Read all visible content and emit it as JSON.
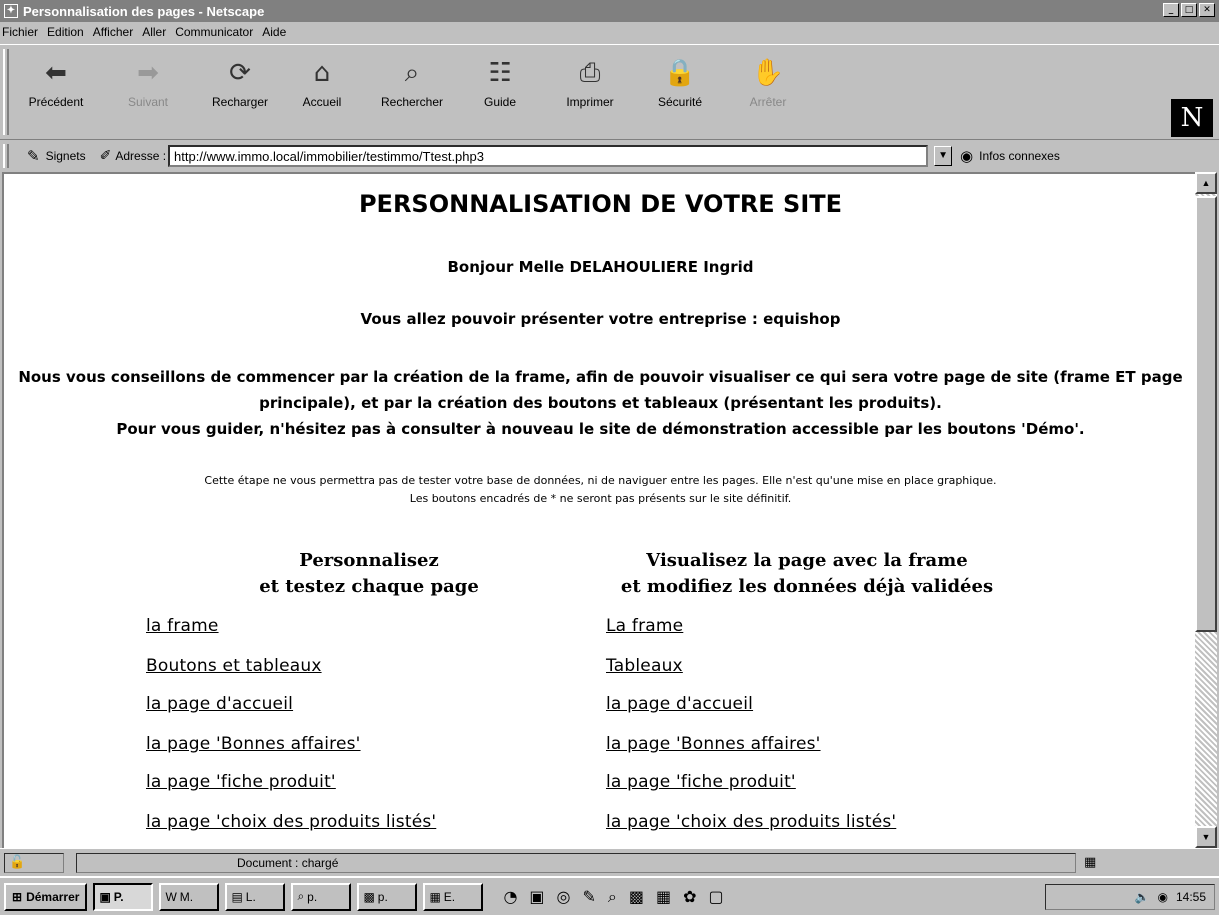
{
  "window": {
    "title": "Personnalisation des pages - Netscape"
  },
  "menu": [
    "Fichier",
    "Edition",
    "Afficher",
    "Aller",
    "Communicator",
    "Aide"
  ],
  "toolbar": {
    "buttons": [
      {
        "label": "Précédent",
        "icon": "back-icon",
        "glyph": "⬅"
      },
      {
        "label": "Suivant",
        "icon": "forward-icon",
        "glyph": "➡"
      },
      {
        "label": "Recharger",
        "icon": "reload-icon",
        "glyph": "⟳"
      },
      {
        "label": "Accueil",
        "icon": "home-icon",
        "glyph": "⌂"
      },
      {
        "label": "Rechercher",
        "icon": "search-icon",
        "glyph": "⌕"
      },
      {
        "label": "Guide",
        "icon": "guide-icon",
        "glyph": "☷"
      },
      {
        "label": "Imprimer",
        "icon": "print-icon",
        "glyph": "⎙"
      },
      {
        "label": "Sécurité",
        "icon": "security-icon",
        "glyph": "🔒"
      },
      {
        "label": "Arrêter",
        "icon": "stop-icon",
        "glyph": "✋"
      }
    ],
    "logo": "N"
  },
  "location": {
    "bookmarks_label": "Signets",
    "address_label": "Adresse :",
    "url": "http://www.immo.local/immobilier/testimmo/Ttest.php3",
    "related_label": "Infos connexes"
  },
  "page": {
    "title": "PERSONNALISATION DE VOTRE SITE",
    "greeting": "Bonjour Melle DELAHOULIERE Ingrid",
    "intro": "Vous allez pouvoir présenter votre entreprise : equishop",
    "advice_1": "Nous vous conseillons de commencer par la création de la frame, afin de pouvoir visualiser ce qui sera votre page de site (frame ET page principale), et par la création des boutons et tableaux (présentant les produits).",
    "advice_2": "Pour vous guider, n'hésitez pas à consulter à nouveau le site de démonstration accessible par les boutons 'Démo'.",
    "notice_1": "Cette étape ne vous permettra pas de tester votre base de données, ni de naviguer entre les pages. Elle n'est qu'une mise en place graphique.",
    "notice_2": "Les boutons encadrés de * ne seront pas présents sur le site définitif.",
    "left_heading_1": "Personnalisez",
    "left_heading_2": "et testez chaque page",
    "right_heading_1": "Visualisez la page avec la frame",
    "right_heading_2": "et modifiez les données déjà validées",
    "left_links": [
      "la frame",
      "Boutons et tableaux",
      "la page d'accueil",
      "la page 'Bonnes affaires'",
      "la page 'fiche produit'",
      "la page 'choix des produits listés'"
    ],
    "right_links": [
      "La frame",
      "Tableaux",
      "la page d'accueil",
      "la page 'Bonnes affaires'",
      "la page 'fiche produit'",
      "la page 'choix des produits listés'"
    ]
  },
  "status": {
    "text": "Document : chargé"
  },
  "taskbar": {
    "start_label": "Démarrer",
    "tasks": [
      "P.",
      "M.",
      "L.",
      "p.",
      "p.",
      "E."
    ],
    "clock": "14:55"
  }
}
